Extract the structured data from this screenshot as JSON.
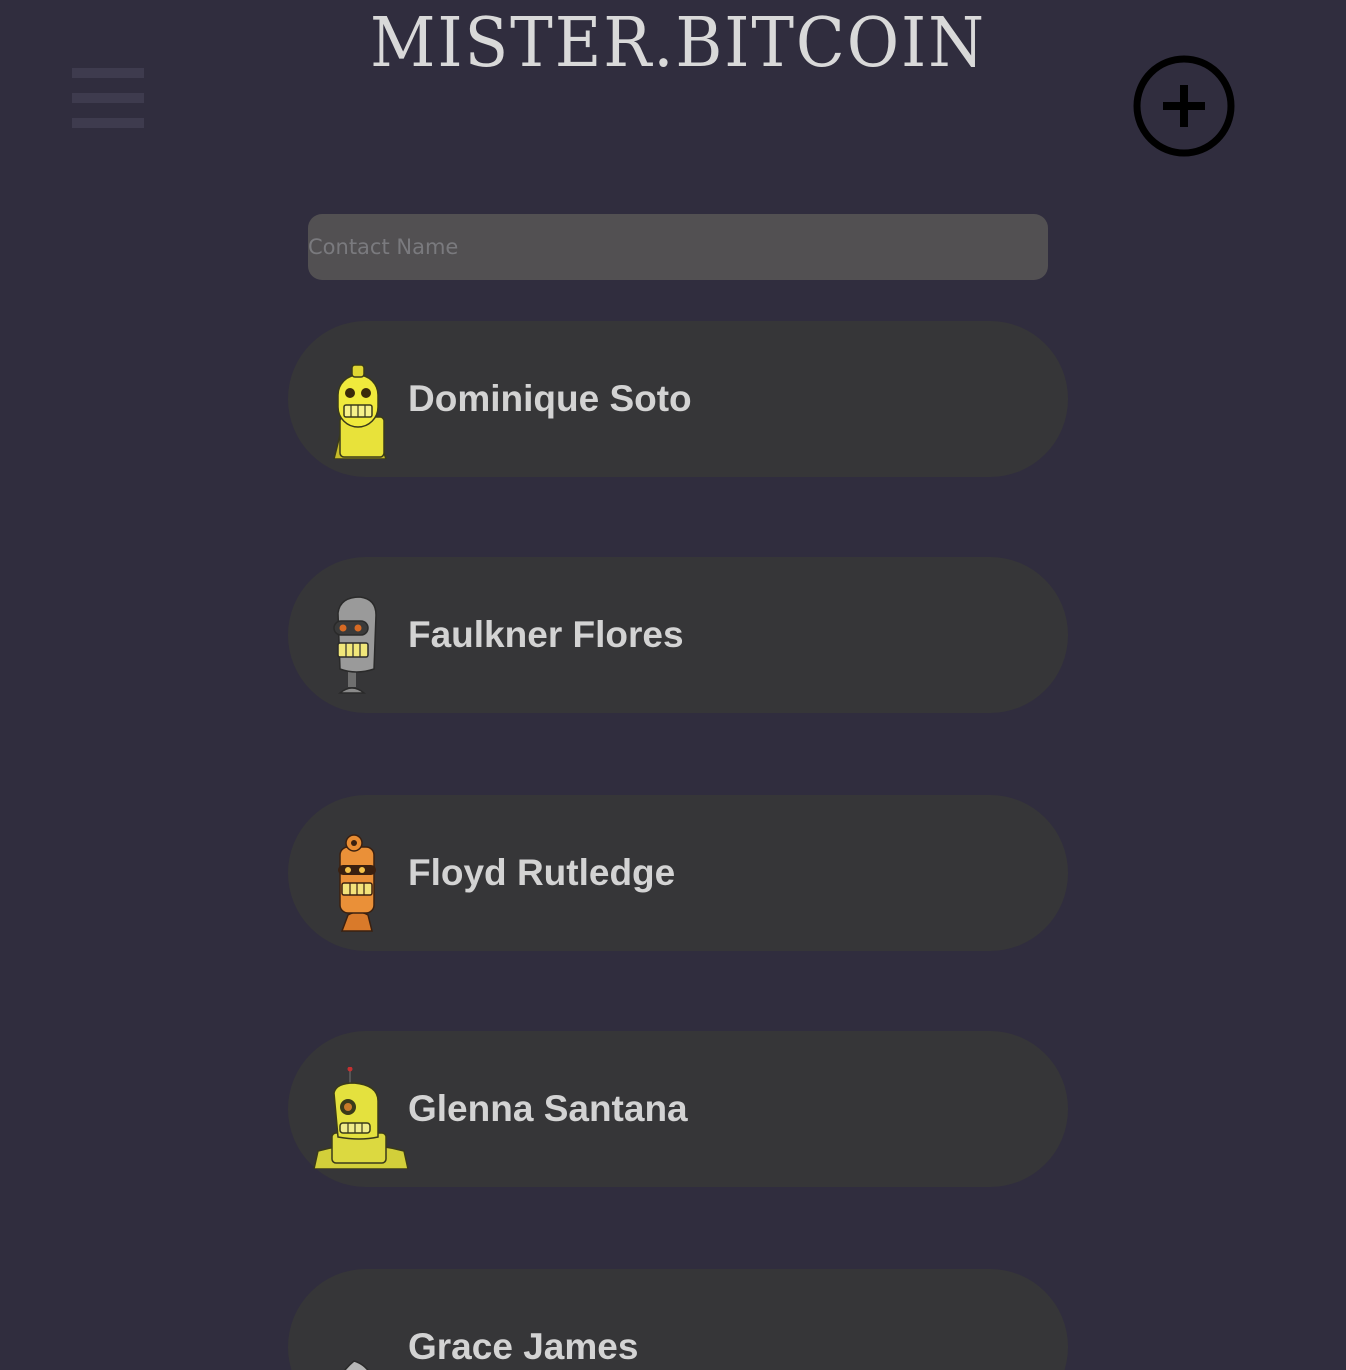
{
  "header": {
    "brand": "MISTER.BITCOIN",
    "menu_icon": "hamburger-menu-icon",
    "add_icon": "add-circle-icon"
  },
  "search": {
    "placeholder": "Contact Name",
    "value": ""
  },
  "contacts": [
    {
      "name": "Dominique Soto",
      "avatar": "yellow-robot-avatar",
      "color": "#e8e23a"
    },
    {
      "name": "Faulkner Flores",
      "avatar": "gray-robot-avatar",
      "color": "#8e8e8e"
    },
    {
      "name": "Floyd Rutledge",
      "avatar": "orange-robot-avatar",
      "color": "#e98d33"
    },
    {
      "name": "Glenna Santana",
      "avatar": "yellow-antenna-robot-avatar",
      "color": "#dcd940"
    },
    {
      "name": "Grace James",
      "avatar": "gray-dome-robot-avatar",
      "color": "#b6b6b6"
    }
  ],
  "colors": {
    "background": "#302d3e",
    "card": "#363638",
    "search_field": "#525052",
    "text": "#d3d3d3"
  }
}
